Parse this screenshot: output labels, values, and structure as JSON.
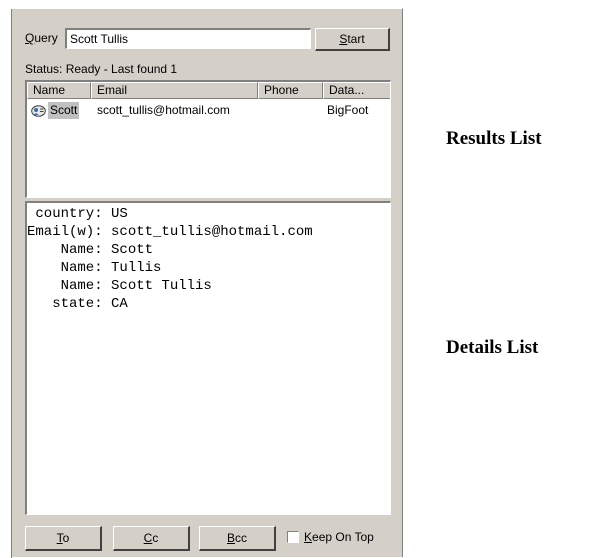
{
  "query": {
    "label_prefix": "",
    "label_access": "Q",
    "label_rest": "uery",
    "value": "Scott Tullis"
  },
  "start_button": {
    "access": "S",
    "rest": "tart"
  },
  "status_text": "Status: Ready - Last found 1",
  "results": {
    "columns": [
      "Name",
      "Email",
      "Phone",
      "Data..."
    ],
    "rows": [
      {
        "name": "Scott",
        "email": "scott_tullis@hotmail.com",
        "phone": "",
        "data": "BigFoot",
        "icon": "person-card-icon"
      }
    ]
  },
  "details_lines": [
    " country: US",
    "Email(w): scott_tullis@hotmail.com",
    "    Name: Scott",
    "    Name: Tullis",
    "    Name: Scott Tullis",
    "   state: CA"
  ],
  "buttons": {
    "to": {
      "access": "T",
      "rest": "o"
    },
    "cc": {
      "access": "C",
      "rest": "c"
    },
    "bcc": {
      "access": "B",
      "rest": "cc"
    }
  },
  "keep_on_top": {
    "access": "K",
    "rest": "eep On Top",
    "checked": false
  },
  "callouts": {
    "results": "Results List",
    "details": "Details List"
  }
}
